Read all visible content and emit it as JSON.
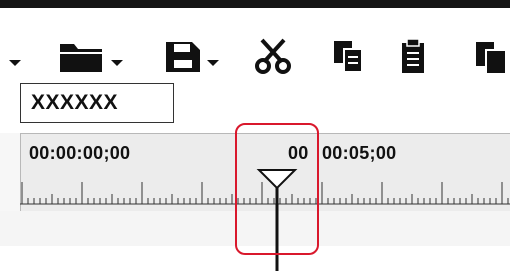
{
  "toolbar": {
    "items": [
      {
        "name": "overflow-dropdown-icon",
        "has_dropdown": false
      },
      {
        "name": "open-folder-icon",
        "has_dropdown": true
      },
      {
        "name": "save-icon",
        "has_dropdown": true
      },
      {
        "name": "cut-icon",
        "has_dropdown": false
      },
      {
        "name": "copy-icon",
        "has_dropdown": false
      },
      {
        "name": "paste-icon",
        "has_dropdown": false
      },
      {
        "name": "paste-insert-icon",
        "has_dropdown": false
      }
    ]
  },
  "clip_name": "XXXXXX",
  "timeline": {
    "start_timecode": "00:00:00;00",
    "cursor_timecode_partial": "00",
    "next_timecode": "00:05;00"
  },
  "colors": {
    "highlight": "#d9182c",
    "panel": "#ececec",
    "icon": "#111111"
  }
}
